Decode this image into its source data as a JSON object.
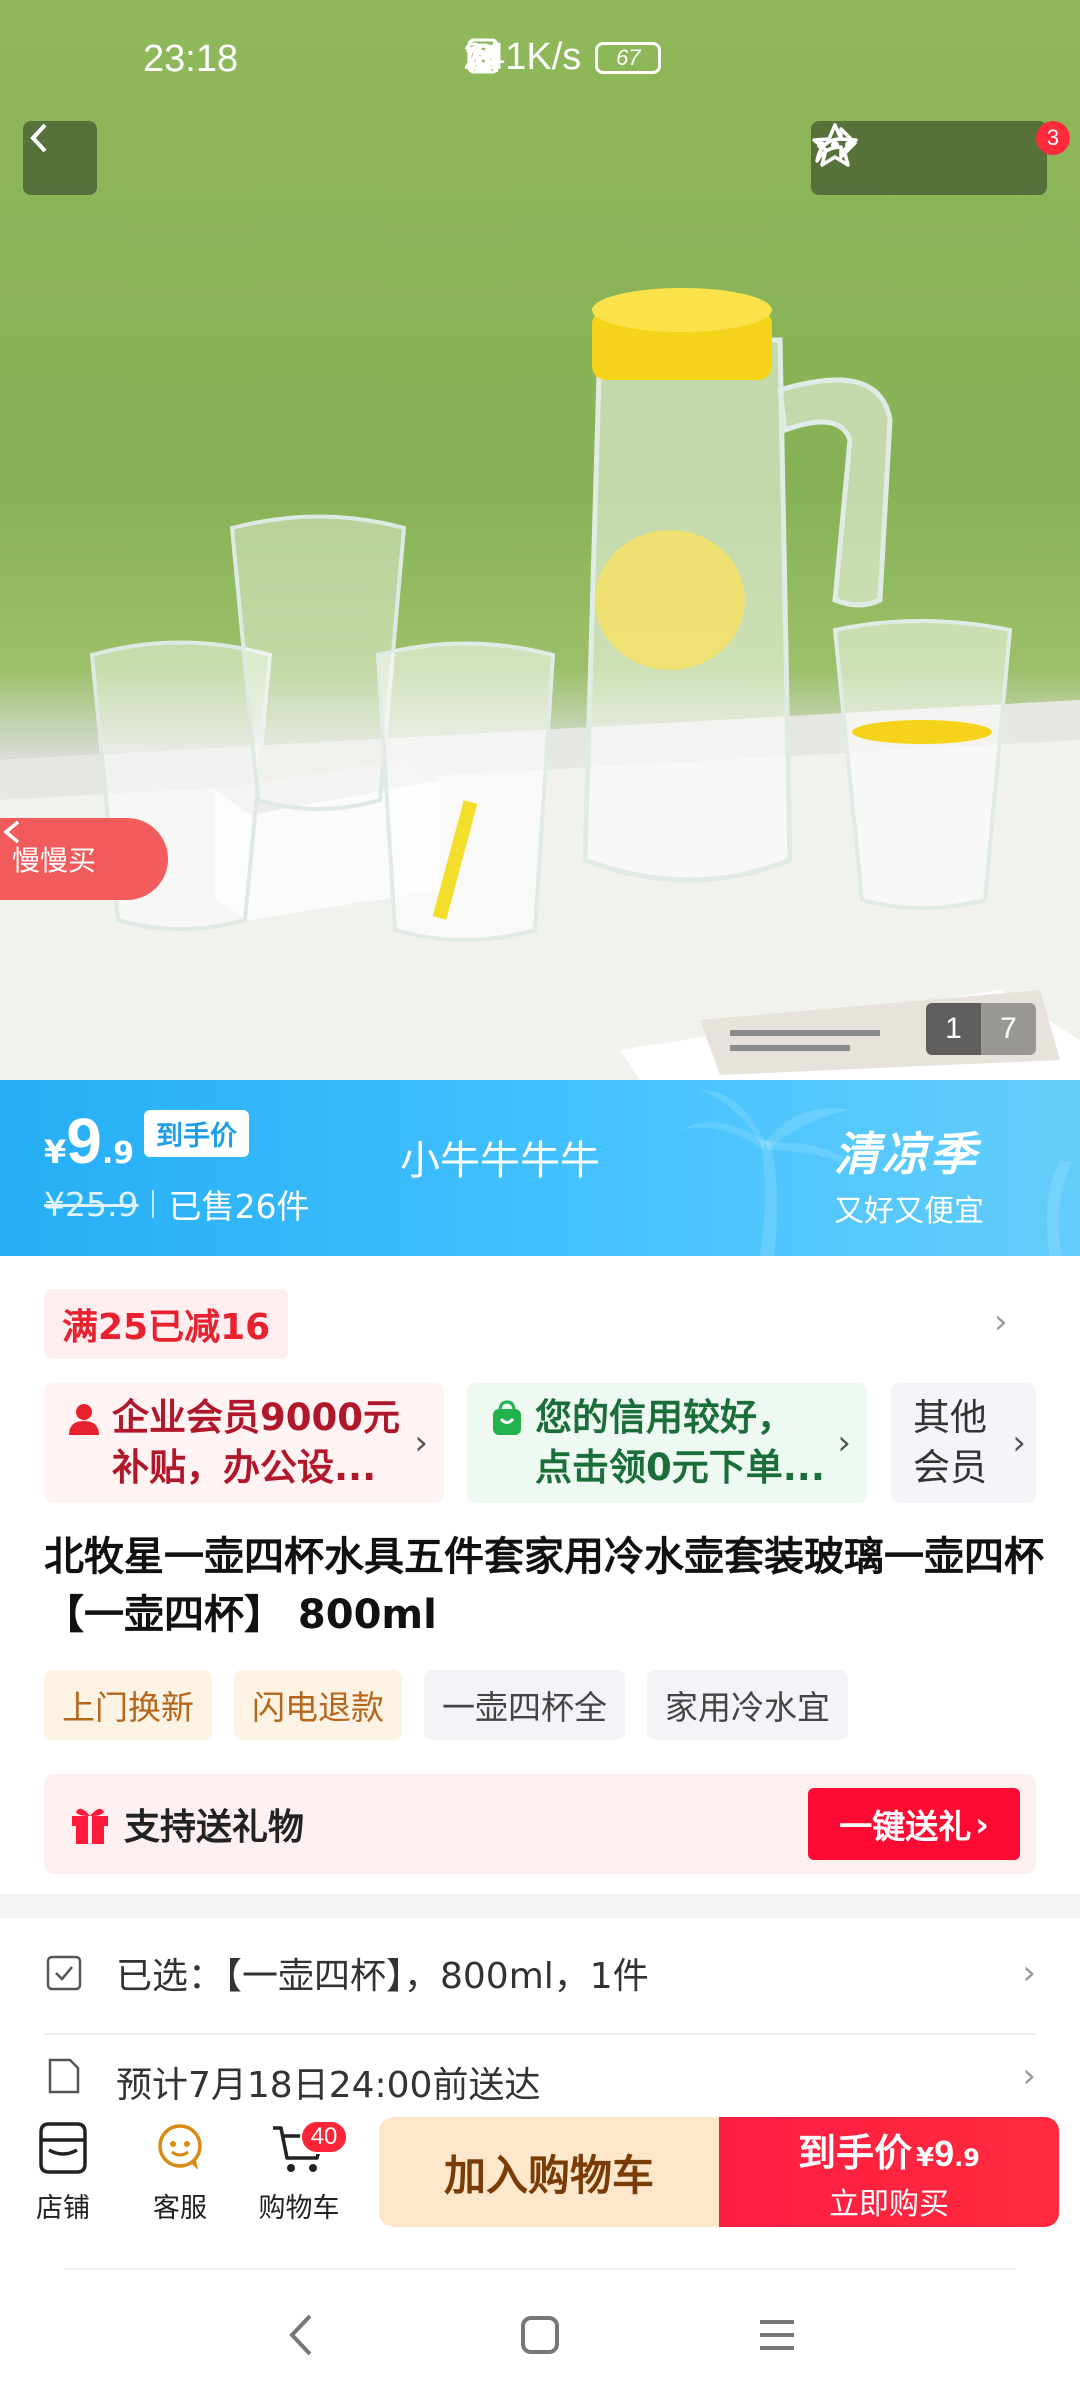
{
  "status_bar": {
    "time": "23:18",
    "net_speed": "241K/s",
    "battery": "67"
  },
  "hero": {
    "msg_badge": "3",
    "slow_buy": "慢慢买",
    "image_index": "1",
    "image_total": "7",
    "colors": {
      "background_green": "#8fb85a",
      "lid_yellow": "#f5d31a"
    }
  },
  "price_banner": {
    "currency": "¥",
    "price_int": "9",
    "price_dec": ".9",
    "price_tag": "到手价",
    "original_price": "¥25.9",
    "sold": "已售26件",
    "shop_name": "小牛牛牛牛",
    "season_title": "清凉季",
    "season_sub": "又好又便宜",
    "accent": "#2aaff5"
  },
  "promo": {
    "reduce": "满25已减16",
    "card_member": "企业会员9000元补贴，办公设...",
    "card_credit": "您的信用较好，点击领0元下单...",
    "card_other": "其他会员"
  },
  "product": {
    "title": "北牧星一壶四杯水具五件套家用冷水壶套装玻璃一壶四杯 【一壶四杯】 800ml",
    "tags": [
      "上门换新",
      "闪电退款",
      "一壶四杯全",
      "家用冷水宜"
    ]
  },
  "gift": {
    "label": "支持送礼物",
    "button": "一键送礼",
    "button_color": "#ff0a32"
  },
  "selection": {
    "selected": "已选：【一壶四杯】，800ml，1件",
    "delivery": "预计7月18日24:00前送达"
  },
  "bottom_bar": {
    "store": "店铺",
    "service": "客服",
    "cart": "购物车",
    "cart_count": "40",
    "add_to_cart": "加入购物车",
    "buy_label": "到手价",
    "buy_currency": "¥",
    "buy_int": "9",
    "buy_dec": ".9",
    "buy_now": "立即购买"
  }
}
